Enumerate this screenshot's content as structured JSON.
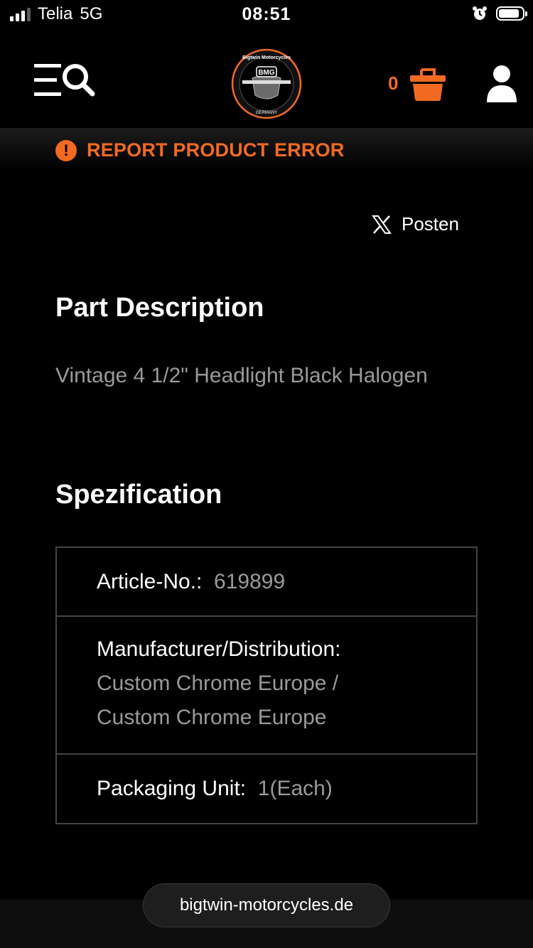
{
  "status_bar": {
    "carrier": "Telia",
    "network": "5G",
    "time": "08:51"
  },
  "header": {
    "logo": {
      "top_text": "Bigtwin Motorcycles",
      "center_text": "BMG",
      "bottom_text": "GERMANY"
    },
    "cart_count": "0",
    "icons": [
      "menu-search-icon",
      "cart-icon",
      "user-icon"
    ]
  },
  "report": {
    "label": "REPORT PRODUCT ERROR",
    "icon": "!"
  },
  "share": {
    "label": "Posten"
  },
  "part_description": {
    "title": "Part Description",
    "text": "Vintage 4 1/2\" Headlight Black Halogen"
  },
  "specification": {
    "title": "Spezification",
    "rows": [
      {
        "label": "Article-No.:",
        "value": "619899"
      },
      {
        "label": "Manufacturer/Distribution:",
        "value_line1": "Custom Chrome Europe /",
        "value_line2": "Custom Chrome Europe"
      },
      {
        "label": "Packaging Unit:",
        "value": "1(Each)"
      }
    ]
  },
  "browser": {
    "url": "bigtwin-motorcycles.de"
  },
  "colors": {
    "accent": "#f26a21",
    "muted_text": "#9a9a9a",
    "border": "#444444"
  }
}
